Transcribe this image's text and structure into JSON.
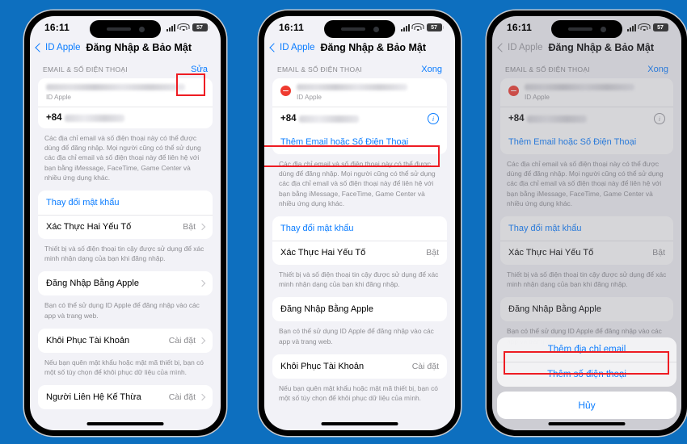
{
  "status_bar": {
    "time": "16:11",
    "battery": "57",
    "wifi_icon": "wifi-icon",
    "signal_icon": "cellular-signal-icon",
    "battery_icon": "battery-icon"
  },
  "nav": {
    "back_label": "ID Apple",
    "title": "Đăng Nhập & Bảo Mật"
  },
  "section": {
    "header": "EMAIL & SỐ ĐIỆN THOẠI",
    "edit_action": "Sửa",
    "done_action": "Xong"
  },
  "account": {
    "sub_label": "ID Apple",
    "phone_prefix": "+84",
    "info_icon": "info-icon",
    "remove_icon": "remove-minus-icon"
  },
  "add_contact": {
    "label": "Thêm Email hoặc Số Điện Thoại"
  },
  "notes": {
    "contact": "Các địa chỉ email và số điện thoại này có thể được dùng để đăng nhập. Mọi người cũng có thể sử dụng các địa chỉ email và số điện thoại này để liên hệ với bạn bằng iMessage, FaceTime, Game Center và nhiều ứng dụng khác.",
    "twofactor": "Thiết bị và số điện thoại tin cậy được sử dụng để xác minh nhận dạng của bạn khi đăng nhập.",
    "signin": "Bạn có thể sử dụng ID Apple để đăng nhập vào các app và trang web.",
    "recovery": "Nếu bạn quên mật khẩu hoặc mật mã thiết bị, bạn có một số tùy chọn để khôi phục dữ liệu của mình."
  },
  "rows": {
    "change_password": "Thay đổi mật khẩu",
    "two_factor": "Xác Thực Hai Yếu Tố",
    "two_factor_value": "Bật",
    "signin_apple": "Đăng Nhập Bằng Apple",
    "account_recovery": "Khôi Phục Tài Khoản",
    "account_recovery_value": "Cài đặt",
    "legacy_contact": "Người Liên Hệ Kế Thừa",
    "legacy_contact_value": "Cài đặt"
  },
  "action_sheet": {
    "add_email": "Thêm địa chỉ email",
    "add_phone": "Thêm số điện thoại",
    "cancel": "Hủy"
  },
  "colors": {
    "accent": "#0a7cff",
    "highlight": "#ee1c23",
    "backdrop": "#0d6fbf",
    "destructive": "#ef3b30"
  }
}
